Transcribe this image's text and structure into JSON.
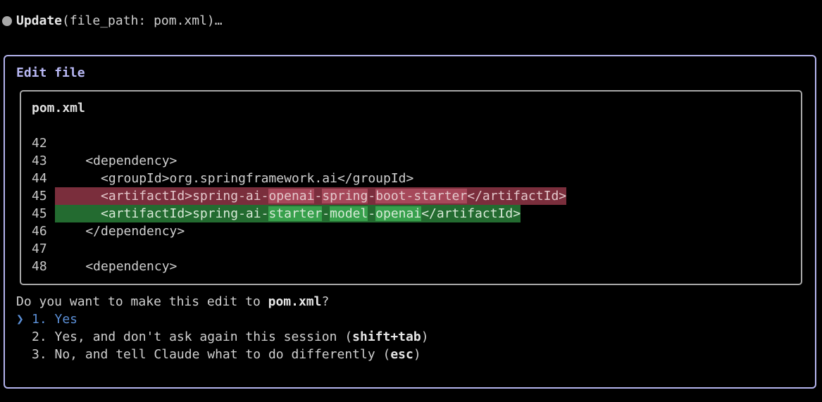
{
  "header": {
    "tool_name": "Update",
    "tool_args": "(file_path: pom.xml)…"
  },
  "panel": {
    "title": "Edit file",
    "file_name": "pom.xml",
    "lines": [
      {
        "num": "42",
        "type": "context",
        "segments": [
          {
            "text": "",
            "hl": false
          }
        ]
      },
      {
        "num": "43",
        "type": "context",
        "segments": [
          {
            "text": "    <dependency>",
            "hl": false
          }
        ]
      },
      {
        "num": "44",
        "type": "context",
        "segments": [
          {
            "text": "      <groupId>org.springframework.ai</groupId>",
            "hl": false
          }
        ]
      },
      {
        "num": "45",
        "type": "removed",
        "segments": [
          {
            "text": "      <artifactId>spring-ai-",
            "hl": false
          },
          {
            "text": "openai",
            "hl": true
          },
          {
            "text": "-",
            "hl": false
          },
          {
            "text": "spring",
            "hl": true
          },
          {
            "text": "-",
            "hl": false
          },
          {
            "text": "boot-starter",
            "hl": true
          },
          {
            "text": "</artifactId>",
            "hl": false
          }
        ]
      },
      {
        "num": "45",
        "type": "added",
        "segments": [
          {
            "text": "      <artifactId>spring-ai-",
            "hl": false
          },
          {
            "text": "starter",
            "hl": true
          },
          {
            "text": "-",
            "hl": false
          },
          {
            "text": "model",
            "hl": true
          },
          {
            "text": "-",
            "hl": false
          },
          {
            "text": "openai",
            "hl": true
          },
          {
            "text": "</artifactId>",
            "hl": false
          }
        ]
      },
      {
        "num": "46",
        "type": "context",
        "segments": [
          {
            "text": "    </dependency>",
            "hl": false
          }
        ]
      },
      {
        "num": "47",
        "type": "context",
        "segments": [
          {
            "text": "",
            "hl": false
          }
        ]
      },
      {
        "num": "48",
        "type": "context",
        "segments": [
          {
            "text": "    <dependency>",
            "hl": false
          }
        ]
      }
    ]
  },
  "prompt": {
    "prefix": "Do you want to make this edit to ",
    "file": "pom.xml",
    "suffix": "?"
  },
  "options": [
    {
      "cursor": "❯",
      "text": "1. Yes",
      "shortcut": "",
      "selected": true
    },
    {
      "cursor": "",
      "text": "2. Yes, and don't ask again this session (",
      "shortcut": "shift+tab",
      "close": ")",
      "selected": false
    },
    {
      "cursor": "",
      "text": "3. No, and tell Claude what to do differently (",
      "shortcut": "esc",
      "close": ")",
      "selected": false
    }
  ],
  "colors": {
    "border_outer": "#b4b4ee",
    "title": "#b8b8f4",
    "removed_bg": "#7a2e3c",
    "removed_hl": "#a6485a",
    "added_bg": "#236b30",
    "added_hl": "#37a04c",
    "selected": "#5b8fd6"
  }
}
